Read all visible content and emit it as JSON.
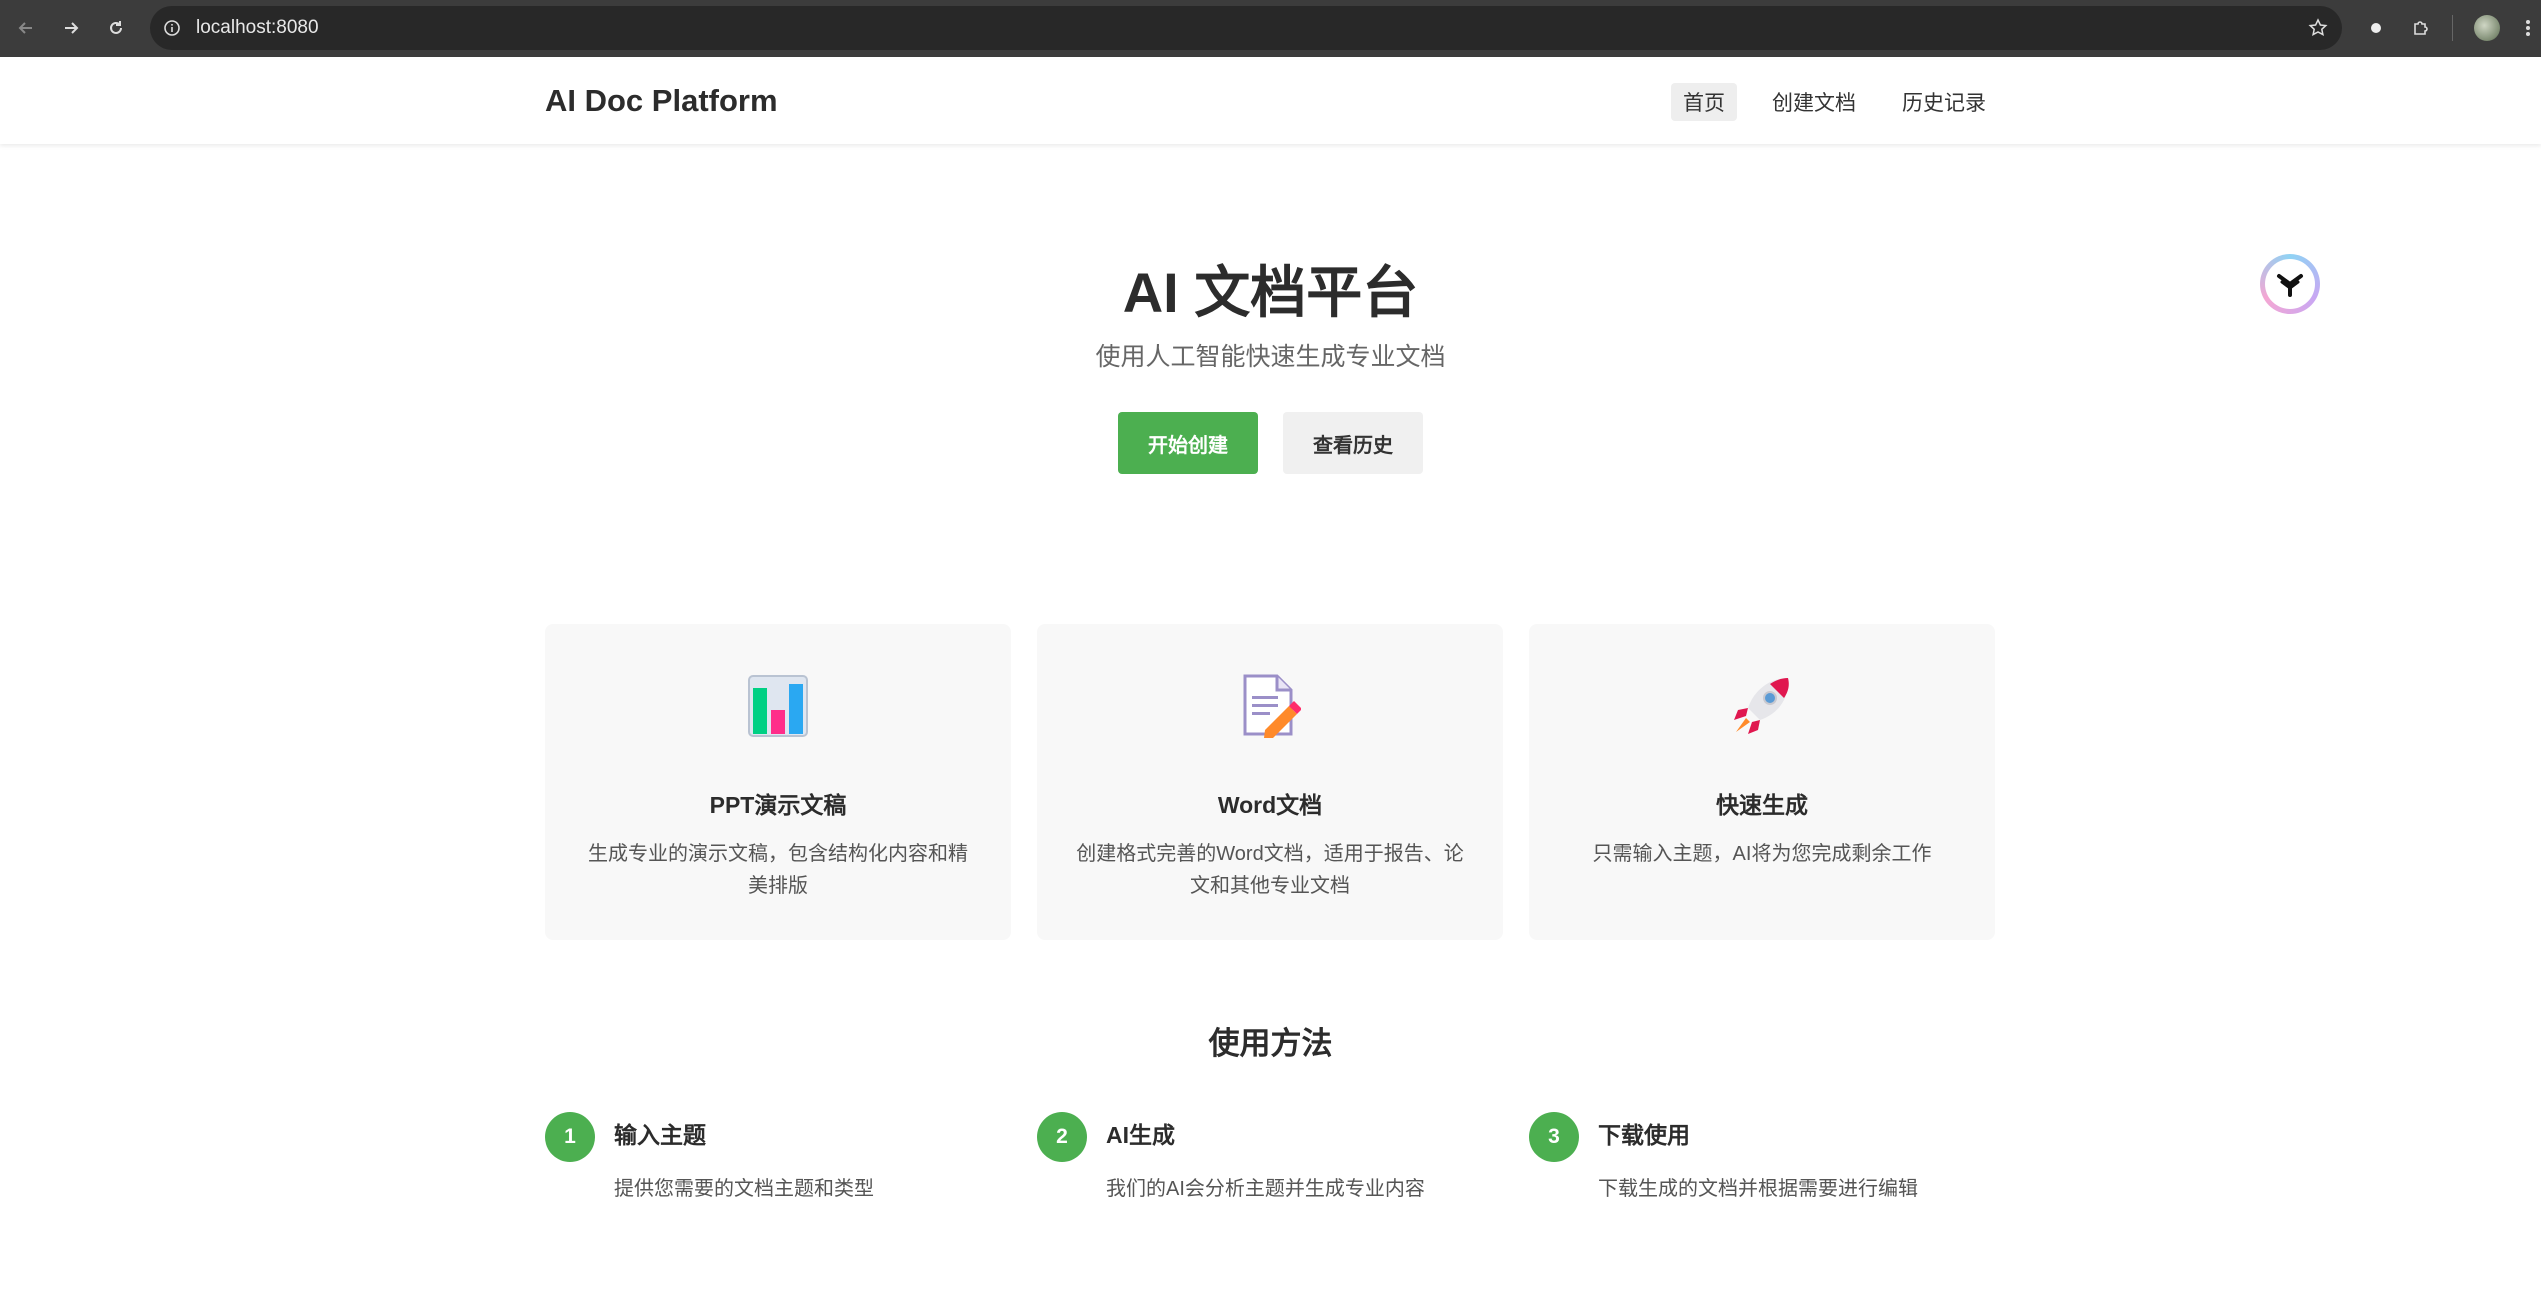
{
  "browser": {
    "url": "localhost:8080",
    "icons": [
      "back-icon",
      "forward-icon",
      "reload-icon",
      "info-icon",
      "star-icon",
      "extension-dot-icon",
      "puzzle-icon",
      "menu-icon"
    ]
  },
  "header": {
    "brand": "AI Doc Platform",
    "nav": [
      "首页",
      "创建文档",
      "历史记录"
    ],
    "active_nav": "首页"
  },
  "hero": {
    "title": "AI 文档平台",
    "subtitle": "使用人工智能快速生成专业文档",
    "primary_button": "开始创建",
    "secondary_button": "查看历史"
  },
  "features": [
    {
      "icon": "bar-chart-icon",
      "title": "PPT演示文稿",
      "desc": "生成专业的演示文稿，包含结构化内容和精美排版"
    },
    {
      "icon": "document-pencil-icon",
      "title": "Word文档",
      "desc": "创建格式完善的Word文档，适用于报告、论文和其他专业文档"
    },
    {
      "icon": "rocket-icon",
      "title": "快速生成",
      "desc": "只需输入主题，AI将为您完成剩余工作"
    }
  ],
  "howto": {
    "title": "使用方法",
    "steps": [
      {
        "num": "1",
        "title": "输入主题",
        "desc": "提供您需要的文档主题和类型"
      },
      {
        "num": "2",
        "title": "AI生成",
        "desc": "我们的AI会分析主题并生成专业内容"
      },
      {
        "num": "3",
        "title": "下载使用",
        "desc": "下载生成的文档并根据需要进行编辑"
      }
    ]
  },
  "colors": {
    "accent": "#4caf50",
    "chrome": "#3c3c3c",
    "card_bg": "#f8f8f8"
  }
}
